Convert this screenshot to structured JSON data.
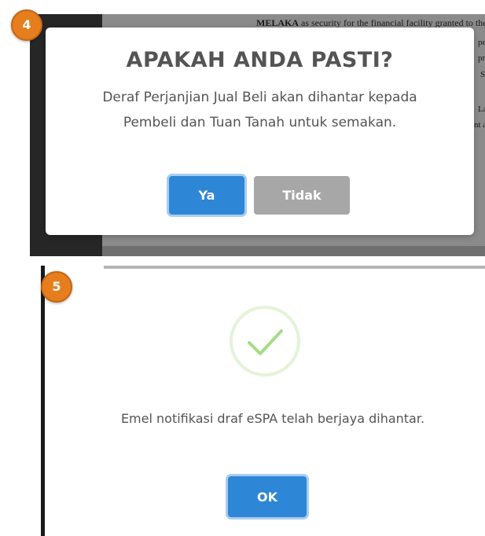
{
  "step_badges": {
    "first": "4",
    "second": "5"
  },
  "background_document": {
    "top_line_bold": "MELAKA",
    "top_line_rest": " as security for the financial facility granted to the Develop",
    "side_fragments": [
      "pe",
      "pr",
      "S",
      "La",
      "nt a"
    ]
  },
  "confirm_dialog": {
    "title": "APAKAH ANDA PASTI?",
    "message": "Deraf Perjanjian Jual Beli akan dihantar kepada Pembeli dan Tuan Tanah untuk semakan.",
    "confirm_label": "Ya",
    "cancel_label": "Tidak"
  },
  "success_dialog": {
    "icon": "check-icon",
    "message": "Emel notifikasi draf eSPA telah berjaya dihantar.",
    "ok_label": "OK"
  },
  "colors": {
    "primary_button": "#2e86d6",
    "cancel_button": "#a7a7a7",
    "badge": "#e67e1e",
    "success_check": "#a5dc86"
  }
}
